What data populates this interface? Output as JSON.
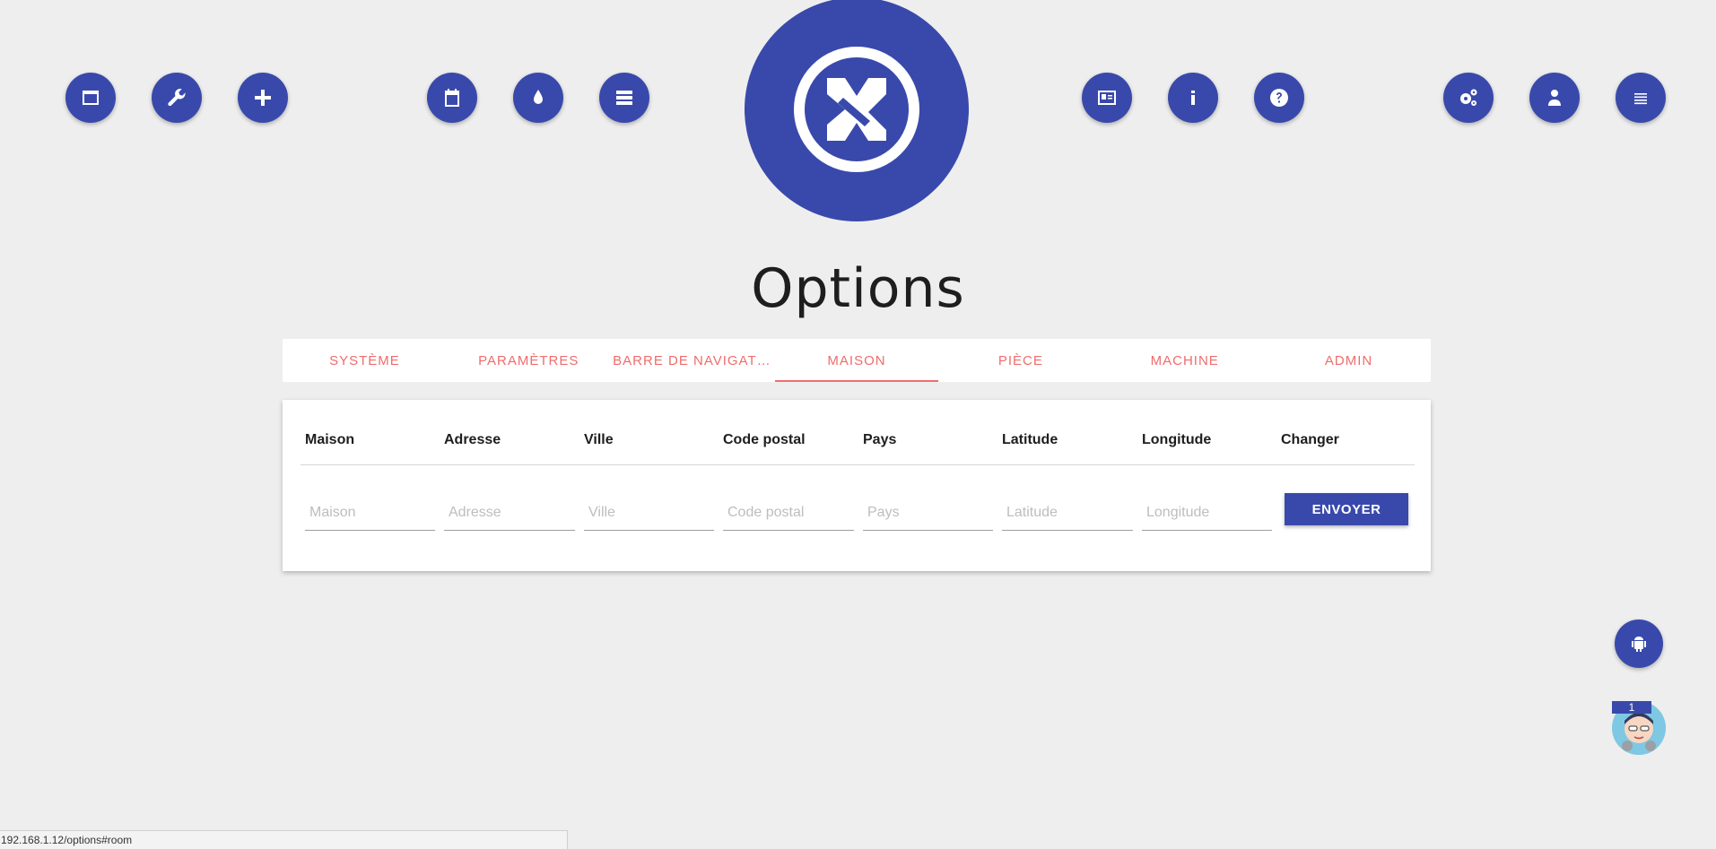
{
  "page": {
    "title": "Options"
  },
  "nav_left": [
    {
      "icon": "window-icon"
    },
    {
      "icon": "wrench-icon"
    },
    {
      "icon": "plus-icon"
    }
  ],
  "nav_center_left": [
    {
      "icon": "calendar-icon"
    },
    {
      "icon": "drop-icon"
    },
    {
      "icon": "storage-icon"
    }
  ],
  "nav_center_right": [
    {
      "icon": "id-card-icon"
    },
    {
      "icon": "info-icon"
    },
    {
      "icon": "help-icon"
    }
  ],
  "nav_right": [
    {
      "icon": "settings-gears-icon"
    },
    {
      "icon": "user-icon"
    },
    {
      "icon": "menu-icon"
    }
  ],
  "tabs": [
    {
      "label": "SYSTÈME",
      "active": false
    },
    {
      "label": "PARAMÈTRES",
      "active": false
    },
    {
      "label": "BARRE DE NAVIGATION",
      "active": false
    },
    {
      "label": "MAISON",
      "active": true
    },
    {
      "label": "PIÈCE",
      "active": false
    },
    {
      "label": "MACHINE",
      "active": false
    },
    {
      "label": "ADMIN",
      "active": false
    }
  ],
  "table": {
    "headers": [
      "Maison",
      "Adresse",
      "Ville",
      "Code postal",
      "Pays",
      "Latitude",
      "Longitude",
      "Changer"
    ],
    "placeholders": [
      "Maison",
      "Adresse",
      "Ville",
      "Code postal",
      "Pays",
      "Latitude",
      "Longitude"
    ],
    "values": [
      "",
      "",
      "",
      "",
      "",
      "",
      ""
    ],
    "submit_label": "ENVOYER"
  },
  "notification": {
    "count": "1"
  },
  "status_bar": {
    "url": "192.168.1.12/options#room"
  },
  "colors": {
    "primary": "#3949ab",
    "accent": "#ef6c6c",
    "background": "#eeeeee"
  }
}
